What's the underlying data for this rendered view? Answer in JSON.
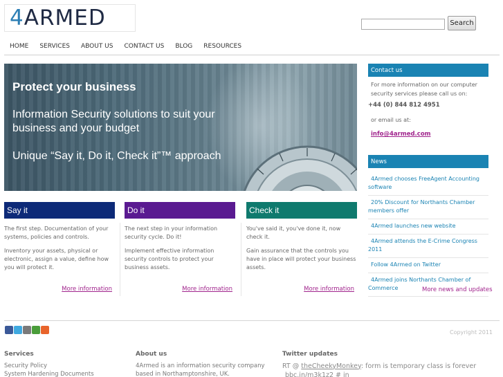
{
  "brand": {
    "logo_text": "ARMED",
    "logo_digit": "4"
  },
  "search": {
    "placeholder": "",
    "button_label": "Search"
  },
  "nav": [
    "HOME",
    "SERVICES",
    "ABOUT US",
    "CONTACT US",
    "BLOG",
    "RESOURCES"
  ],
  "hero": {
    "title": "Protect your business",
    "line1": "Information Security solutions to suit your business and your budget",
    "line2": "Unique “Say it, Do it, Check it”™ approach"
  },
  "columns": [
    {
      "title": "Say it",
      "color": "#0d2a78",
      "p1": "The first step. Documentation of your systems, policies and controls.",
      "p2": "Inventory your assets, physical or electronic, assign a value, define how you will protect it.",
      "more": "More information"
    },
    {
      "title": "Do it",
      "color": "#5a1a91",
      "p1": "The next step in your information security cycle. Do it!",
      "p2": "Implement effective information security controls to protect your business assets.",
      "more": "More information"
    },
    {
      "title": "Check it",
      "color": "#0f7a6e",
      "p1": "You've said it, you've done it, now check it.",
      "p2": "Gain assurance that the controls you have in place will protect your business assets.",
      "more": "More information"
    }
  ],
  "contact": {
    "heading": "Contact us",
    "intro": "For more information on our computer security services please call us on:",
    "phone": "+44 (0) 844 812 4951",
    "or_email": "or email us at:",
    "email": "info@4armed.com"
  },
  "news": {
    "heading": "News",
    "items": [
      "4Armed chooses FreeAgent Accounting software",
      "20% Discount for Northants Chamber members offer",
      "4Armed launches new website",
      "4Armed attends the E-Crime Congress 2011",
      "Follow 4Armed on Twitter",
      "4Armed joins Northants Chamber of Commerce"
    ],
    "more": "More news and updates"
  },
  "social_icons": [
    "facebook-icon",
    "twitter-icon",
    "print-icon",
    "share-icon",
    "add-icon"
  ],
  "copyright": "Copyright 2011",
  "footer": {
    "services": {
      "heading": "Services",
      "links": [
        "Security Policy",
        "System Hardening Documents"
      ]
    },
    "about": {
      "heading": "About us",
      "text": "4Armed is an information security company based in Northamptonshire, UK."
    },
    "twitter": {
      "heading": "Twitter updates",
      "prefix": "RT @",
      "user": "theCheekyMonkey",
      "text": ": form is temporary class is forever",
      "link": "bbc.in/m3k1z2 # in"
    }
  },
  "colors": {
    "accent": "#1a83b3",
    "link": "#a0238c"
  }
}
